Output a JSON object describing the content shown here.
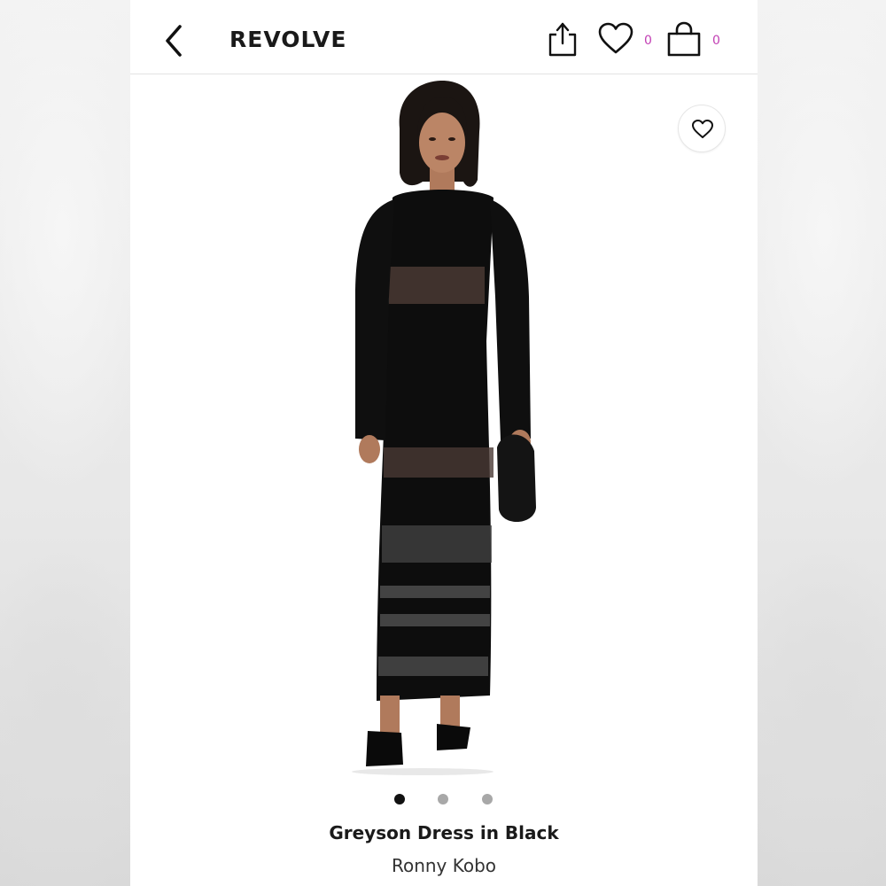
{
  "app": {
    "brand": "REVOLVE",
    "wishlist_count": "0",
    "bag_count": "0",
    "accent_color": "#c23fb4"
  },
  "icons": {
    "back": "chevron-left-icon",
    "share": "share-icon",
    "wishlist": "heart-icon",
    "bag": "shopping-bag-icon",
    "add_to_wishlist": "heart-outline-icon"
  },
  "gallery": {
    "image_description": "Model wearing long-sleeve black knit maxi dress with sheer striped panels, holding black clutch, black pointed heels",
    "dots": [
      {
        "active": true,
        "color": "#111111"
      },
      {
        "active": false,
        "color": "#a8a8a8"
      },
      {
        "active": false,
        "color": "#a8a8a8"
      }
    ]
  },
  "product": {
    "name": "Greyson Dress in Black",
    "designer": "Ronny Kobo"
  }
}
